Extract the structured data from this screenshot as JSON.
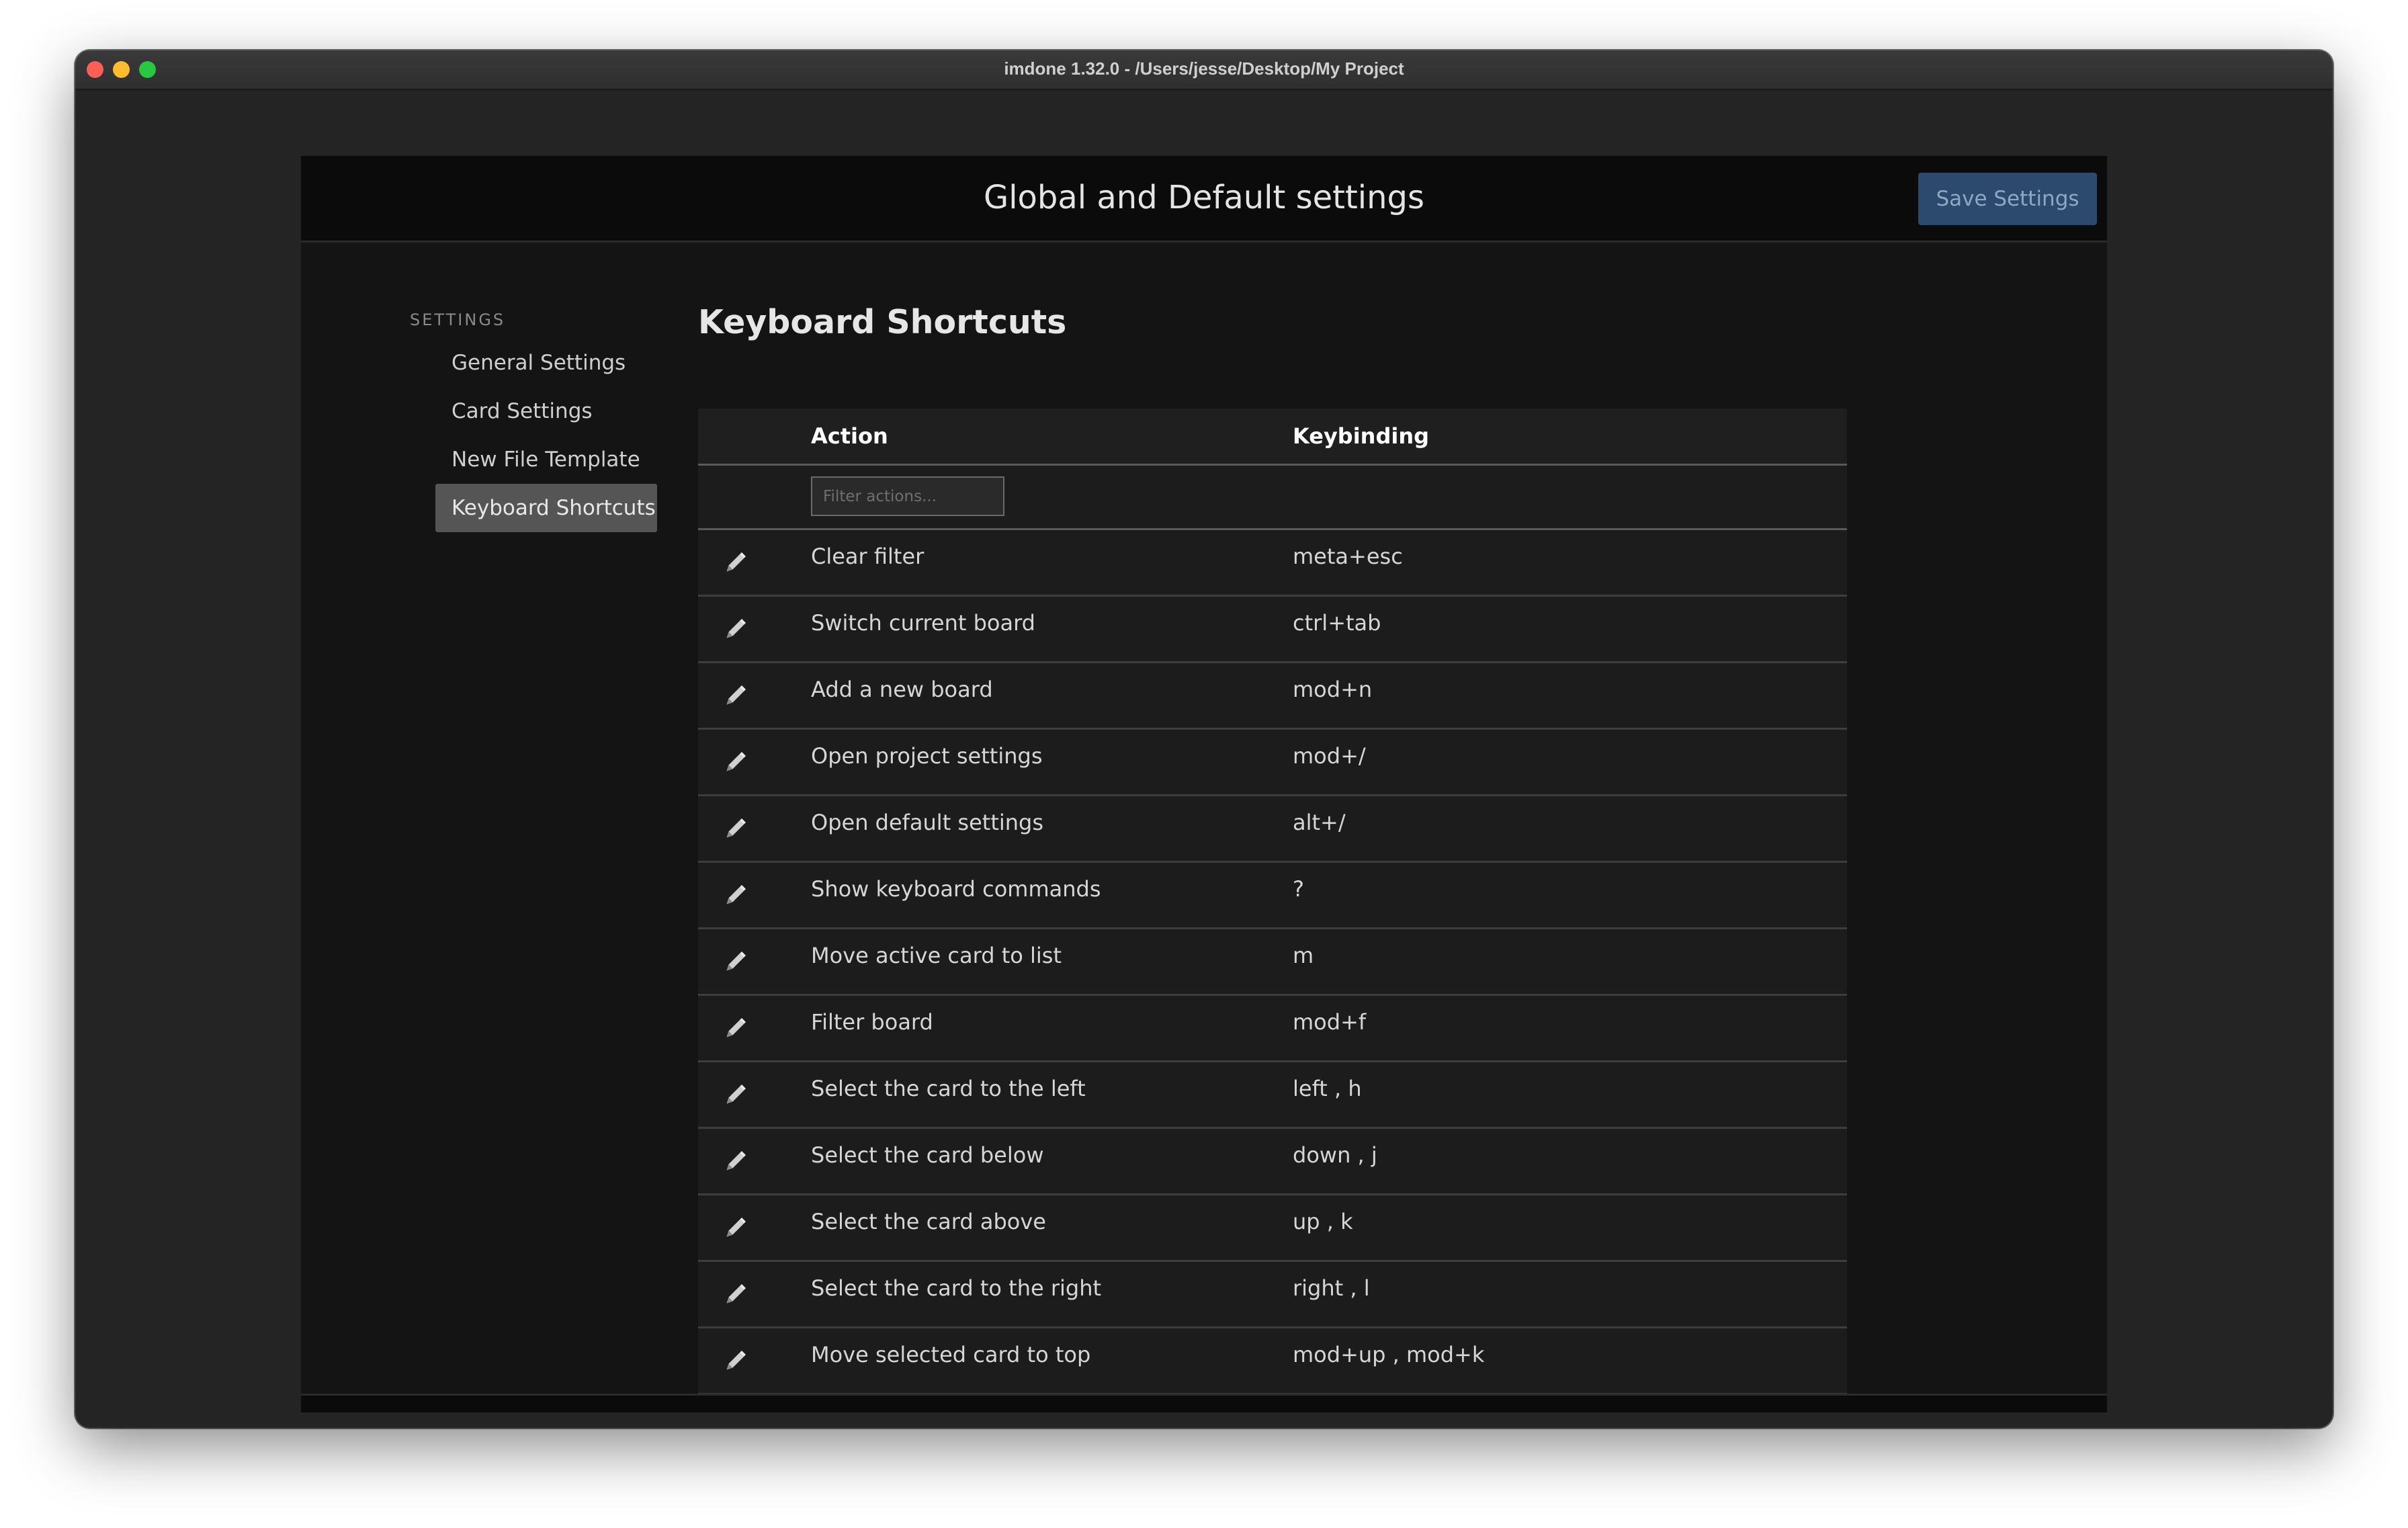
{
  "window": {
    "title": "imdone 1.32.0 - /Users/jesse/Desktop/My Project"
  },
  "modal": {
    "title": "Global and Default settings",
    "save_label": "Save Settings",
    "close_label": "×"
  },
  "sidebar": {
    "heading": "SETTINGS",
    "items": [
      {
        "label": "General Settings",
        "active": false
      },
      {
        "label": "Card Settings",
        "active": false
      },
      {
        "label": "New File Template",
        "active": false
      },
      {
        "label": "Keyboard Shortcuts",
        "active": true
      }
    ]
  },
  "section": {
    "title": "Keyboard Shortcuts"
  },
  "table": {
    "columns": {
      "action": "Action",
      "keybinding": "Keybinding"
    },
    "filter_placeholder": "Filter actions...",
    "rows": [
      {
        "action": "Clear filter",
        "keybinding": "meta+esc"
      },
      {
        "action": "Switch current board",
        "keybinding": "ctrl+tab"
      },
      {
        "action": "Add a new board",
        "keybinding": "mod+n"
      },
      {
        "action": "Open project settings",
        "keybinding": "mod+/"
      },
      {
        "action": "Open default settings",
        "keybinding": "alt+/"
      },
      {
        "action": "Show keyboard commands",
        "keybinding": "?"
      },
      {
        "action": "Move active card to list",
        "keybinding": "m"
      },
      {
        "action": "Filter board",
        "keybinding": "mod+f"
      },
      {
        "action": "Select the card to the left",
        "keybinding": "left , h"
      },
      {
        "action": "Select the card below",
        "keybinding": "down , j"
      },
      {
        "action": "Select the card above",
        "keybinding": "up , k"
      },
      {
        "action": "Select the card to the right",
        "keybinding": "right , l"
      },
      {
        "action": "Move selected card to top",
        "keybinding": "mod+up , mod+k"
      }
    ]
  },
  "colors": {
    "window_bg": "#242424",
    "modal_bg": "#141414",
    "header_bg": "#0b0b0b",
    "save_button_bg": "#2b4a6e",
    "active_nav_bg": "#555555"
  },
  "icons": {
    "row_edit": "pencil-icon",
    "close": "close-icon"
  }
}
